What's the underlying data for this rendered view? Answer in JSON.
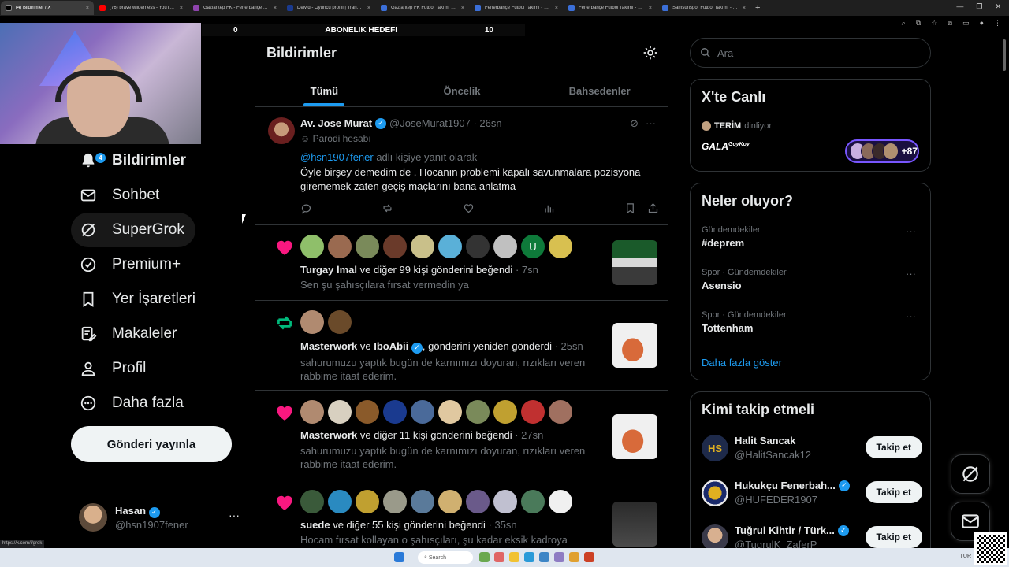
{
  "browser": {
    "tabs": [
      {
        "title": "(4) Bildirimler / X",
        "color": "#000000",
        "active": true
      },
      {
        "title": "(76) brave wilderness - YouTube",
        "color": "#ff0000"
      },
      {
        "title": "Gaziantep FK - Fenerbahçe Ma...",
        "color": "#8e44ad"
      },
      {
        "title": "Delvid - Oyuncu profili | Transfe...",
        "color": "#1a3a8f"
      },
      {
        "title": "Gaziantep FK Futbol Takımı - 20...",
        "color": "#3b6fd8"
      },
      {
        "title": "Fenerbahçe Futbol Takımı - 202...",
        "color": "#3b6fd8"
      },
      {
        "title": "Fenerbahçe Futbol Takımı - 202...",
        "color": "#3b6fd8"
      },
      {
        "title": "Samsunspor Futbol Takımı - 20...",
        "color": "#3b6fd8"
      }
    ],
    "tab_close": "×",
    "new_tab": "+",
    "status_url": "https://x.com/i/grok"
  },
  "overlay": {
    "left_value": "0",
    "title": "ABONELIK HEDEFI",
    "right_value": "10"
  },
  "nav": {
    "badge": "4",
    "items": [
      {
        "label": "Bildirimler"
      },
      {
        "label": "Sohbet"
      },
      {
        "label": "SuperGrok"
      },
      {
        "label": "Premium+"
      },
      {
        "label": "Yer İşaretleri"
      },
      {
        "label": "Makaleler"
      },
      {
        "label": "Profil"
      },
      {
        "label": "Daha fazla"
      }
    ],
    "post_button": "Gönderi yayınla",
    "account": {
      "name": "Hasan",
      "handle": "@hsn1907fener",
      "more": "···"
    }
  },
  "main": {
    "title": "Bildirimler",
    "tabs": [
      "Tümü",
      "Öncelik",
      "Bahsedenler"
    ],
    "tweet": {
      "name": "Av. Jose Murat",
      "handle_time": "@JoseMurat1907 · 26sn",
      "parody": "Parodi hesabı",
      "reply_mention": "@hsn1907fener",
      "reply_suffix": " adlı kişiye yanıt olarak",
      "text": "Öyle birşey demedim de , Hocanın problemi kapalı savunmalara pozisyona girememek zaten geçiş maçlarını bana anlatma"
    },
    "notifications": [
      {
        "kind": "like",
        "actor": "Turgay İmal",
        "action": " ve diğer 99 kişi gönderini beğendi",
        "time": " · 7sn",
        "text": "Sen şu şahısçılara fırsat vermedin ya",
        "avatar_colors": [
          "#8fbf6a",
          "#9a6a50",
          "#7a8a5a",
          "#6a3a2a",
          "#c9c08a",
          "#5ab0d8",
          "#333333",
          "#c0c0c0",
          "#0e7a3a",
          "#d8c050"
        ],
        "avatar_letter": "U"
      },
      {
        "kind": "repost",
        "actor": "Masterwork",
        "actor2": "IboAbii",
        "action_pre": " ve ",
        "action": ", gönderini yeniden gönderdi",
        "time": " · 25sn",
        "text": "sahurumuzu yaptık bugün de karnımızı doyuran, rızıkları veren rabbime itaat ederim.",
        "avatar_colors": [
          "#b08a70",
          "#6a4a2a"
        ]
      },
      {
        "kind": "like",
        "actor": "Masterwork",
        "action": " ve diğer 11 kişi gönderini beğendi",
        "time": " · 27sn",
        "text": "sahurumuzu yaptık bugün de karnımızı doyuran, rızıkları veren rabbime itaat ederim.",
        "avatar_colors": [
          "#b08a70",
          "#d8d0c0",
          "#8a5a2a",
          "#1a3a8f",
          "#4a6a9a",
          "#e0c8a0",
          "#7a8a5a",
          "#c0a030",
          "#c03030",
          "#a07060"
        ]
      },
      {
        "kind": "like",
        "actor": "suede",
        "action": " ve diğer 55 kişi gönderini beğendi",
        "time": " · 35sn",
        "text": "Hocam fırsat kollayan o şahısçıları, şu kadar eksik kadroya",
        "avatar_colors": [
          "#3a5a3a",
          "#2a8ac0",
          "#c0a030",
          "#9a9a8a",
          "#5a7a9a",
          "#d0b070",
          "#6a5a8a",
          "#c0c0d0",
          "#4a7a5a",
          "#f0f0f0"
        ]
      }
    ]
  },
  "right": {
    "search_placeholder": "Ara",
    "live": {
      "title": "X'te Canlı",
      "listener": "TERİM",
      "listening": "dinliyor",
      "show": "GALA",
      "show_sup": "GoyKoy",
      "count": "+87"
    },
    "trends_title": "Neler oluyor?",
    "trends": [
      {
        "category": "Gündemdekiler",
        "name": "#deprem"
      },
      {
        "category": "Spor · Gündemdekiler",
        "name": "Asensio"
      },
      {
        "category": "Spor · Gündemdekiler",
        "name": "Tottenham"
      }
    ],
    "trend_more": "···",
    "show_more": "Daha fazla göster",
    "follow_title": "Kimi takip etmeli",
    "follow": [
      {
        "name": "Halit Sancak",
        "handle": "@HalitSancak12",
        "button": "Takip et",
        "verified": false,
        "color": "#1e2a4a"
      },
      {
        "name": "Hukukçu Fenerbah...",
        "handle": "@HUFEDER1907",
        "button": "Takip et",
        "verified": true,
        "color": "#e8e8e8"
      },
      {
        "name": "Tuğrul Kihtir / Türk...",
        "handle": "@TugrulK_ZaferP",
        "button": "Takip et",
        "verified": true,
        "color": "#c9a27a"
      }
    ]
  },
  "taskbar": {
    "search": "Search",
    "lang": "TUR"
  },
  "colors": {
    "accent": "#1d9bf0",
    "like": "#f91880",
    "repost": "#00ba7c",
    "bg": "#000000"
  }
}
